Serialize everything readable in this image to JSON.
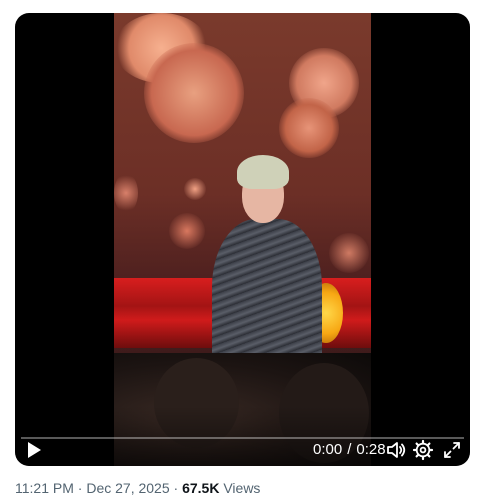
{
  "player": {
    "current_time": "0:00",
    "separator": "/",
    "duration": "0:28",
    "progress": 0
  },
  "icons": {
    "play": "play-icon",
    "volume": "volume-icon",
    "settings": "gear-icon",
    "fullscreen": "fullscreen-icon"
  },
  "post_meta": {
    "time": "11:21 PM",
    "dot1": "·",
    "date": "Dec 27, 2025",
    "dot2": "·",
    "views_count": "67.5K",
    "views_label": "Views"
  }
}
